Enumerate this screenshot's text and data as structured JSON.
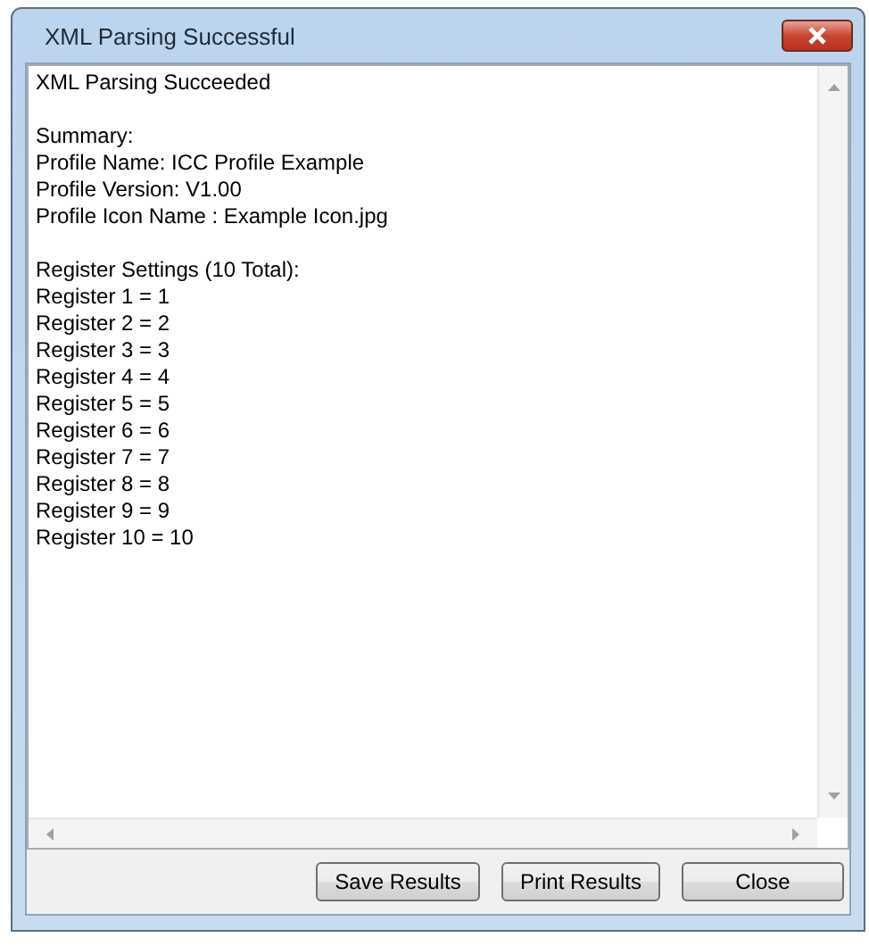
{
  "window": {
    "title": "XML Parsing Successful"
  },
  "results": {
    "paragraphs": [
      [
        "XML Parsing Succeeded"
      ],
      [
        "Summary:",
        "Profile Name: ICC Profile Example",
        "Profile Version: V1.00",
        "Profile Icon Name : Example Icon.jpg"
      ],
      [
        "Register Settings (10 Total):",
        "Register 1 = 1",
        "Register 2 = 2",
        "Register 3 = 3",
        "Register 4 = 4",
        "Register 5 = 5",
        "Register 6 = 6",
        "Register 7 = 7",
        "Register 8 = 8",
        "Register 9 = 9",
        "Register 10 = 10"
      ]
    ]
  },
  "buttons": [
    "Save Results",
    "Print Results",
    "Close"
  ]
}
